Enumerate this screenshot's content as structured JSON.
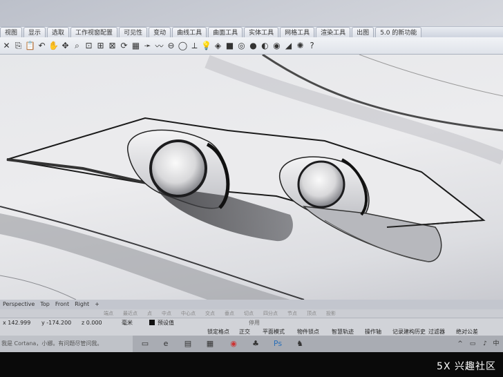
{
  "ribbon": {
    "tabs": [
      "视图",
      "显示",
      "选取",
      "工作视窗配置",
      "可见性",
      "变动",
      "曲线工具",
      "曲面工具",
      "实体工具",
      "网格工具",
      "渲染工具",
      "出图",
      "5.0 的新功能"
    ]
  },
  "toolbar": {
    "icons": [
      "close-icon",
      "copy-icon",
      "paste-icon",
      "undo-icon",
      "pan-hand-icon",
      "move-icon",
      "zoom-icon",
      "zoom-window-icon",
      "zoom-extents-icon",
      "zoom-selected-icon",
      "rotate-view-icon",
      "grid-icon",
      "measure-icon",
      "curve-icon",
      "analyze-icon",
      "ellipse-icon",
      "dimension-icon",
      "light-icon",
      "shade-icon",
      "render-icon",
      "color-wheel-icon",
      "sphere-icon",
      "sphere-dark-icon",
      "material-icon",
      "render-mode-icon",
      "settings-gear-icon",
      "help-icon"
    ]
  },
  "viewport_tabs": [
    "Perspective",
    "Top",
    "Front",
    "Right",
    "+"
  ],
  "osnap": [
    "端点",
    "最近点",
    "点",
    "中点",
    "中心点",
    "交点",
    "垂点",
    "切点",
    "四分点",
    "节点",
    "顶点",
    "投影"
  ],
  "osnap_disable": "停用",
  "status": {
    "x": "x 142.999",
    "y": "y -174.200",
    "z": "z 0.000",
    "unit": "毫米",
    "layer": "预设值",
    "buttons": [
      "锁定格点",
      "正交",
      "平面模式",
      "物件锁点",
      "智慧轨迹",
      "操作轴",
      "记录建构历史",
      "过滤器",
      "绝对公差"
    ]
  },
  "taskbar": {
    "search_placeholder": "我是 Cortana，小娜。有问题尽管问我。",
    "apps": [
      "task-view-icon",
      "edge-icon",
      "explorer-icon",
      "store-icon",
      "netease-music-icon",
      "qq-icon",
      "photoshop-icon",
      "rhino-icon"
    ],
    "tray": [
      "^",
      "▭",
      "♪",
      "中"
    ]
  },
  "watermark": "5X 兴趣社区",
  "colors": {
    "viewport_bg": "#e8e9ec",
    "ribbon_bg": "#dfe3ea",
    "accent_blue": "#3a7fd0"
  }
}
